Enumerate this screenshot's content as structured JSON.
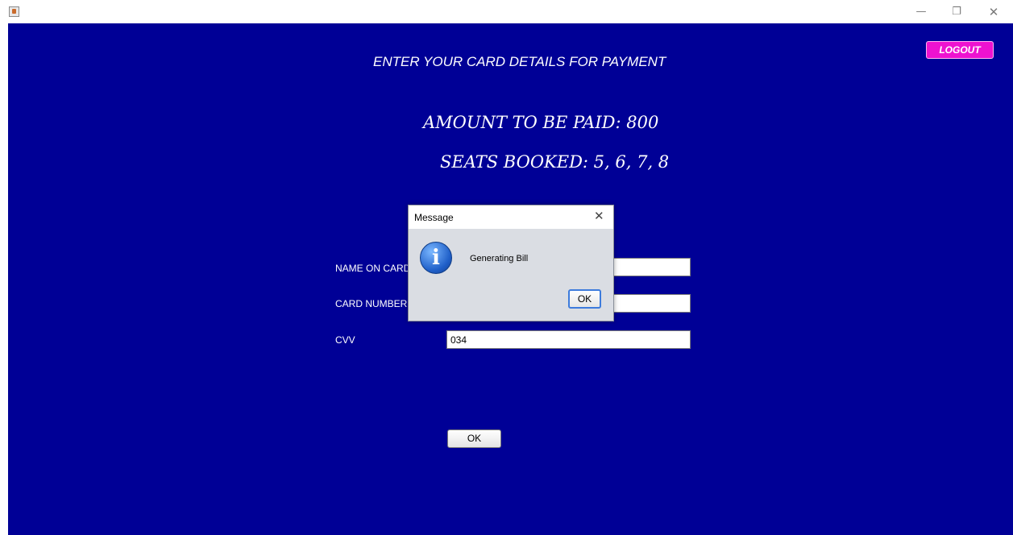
{
  "window": {
    "icons": {
      "app": "java-cup-icon",
      "minimize": "minimize-icon",
      "restore": "restore-icon",
      "close": "close-icon"
    },
    "glyphs": {
      "minimize": "—",
      "restore": "❐",
      "close": "✕"
    }
  },
  "header": {
    "logout_label": "LOGOUT",
    "heading": "ENTER YOUR CARD DETAILS FOR PAYMENT",
    "amount": "AMOUNT TO BE PAID: 800",
    "seats": "SEATS BOOKED: 5, 6, 7, 8"
  },
  "form": {
    "name_label": "NAME ON CARD",
    "name_value": "",
    "card_label": "CARD NUMBER",
    "card_value": "",
    "cvv_label": "CVV",
    "cvv_value": "034",
    "ok_label": "OK"
  },
  "dialog": {
    "title": "Message",
    "close_glyph": "✕",
    "icon_glyph": "i",
    "icon": "info-icon",
    "message": "Generating Bill",
    "ok_label": "OK"
  },
  "colors": {
    "background": "#000096",
    "logout_button": "#ee12d0",
    "text": "#ffffff",
    "dialog_background": "#dadde3"
  }
}
